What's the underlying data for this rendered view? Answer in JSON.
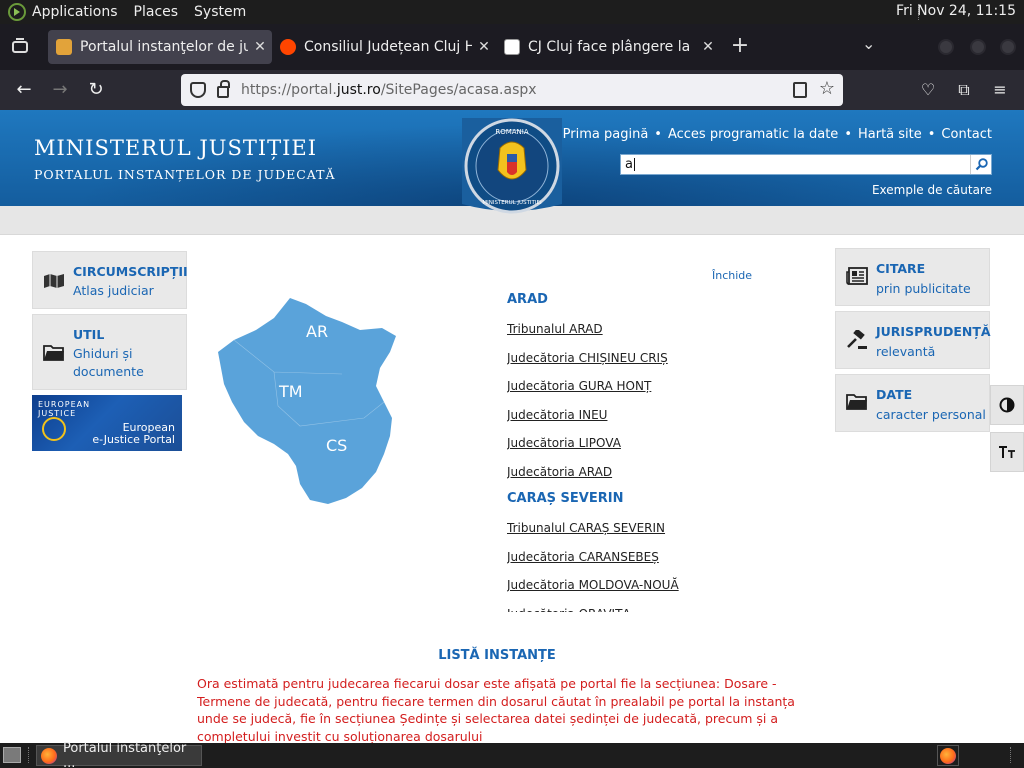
{
  "panel": {
    "menus": [
      "Applications",
      "Places",
      "System"
    ],
    "clock": "Fri Nov 24, 11:15"
  },
  "browser": {
    "tabs": [
      {
        "title": "Portalul instanţelor de judecată",
        "active": true
      },
      {
        "title": "Consiliul Județean Cluj Hacked",
        "active": false
      },
      {
        "title": "CJ Cluj face plângere la DIICOT",
        "active": false
      }
    ],
    "url_prefix": "https://portal.",
    "url_domain": "just.ro",
    "url_path": "/SitePages/acasa.aspx"
  },
  "header": {
    "title": "MINISTERUL JUSTIȚIEI",
    "subtitle": "PORTALUL INSTANȚELOR DE JUDECATĂ",
    "seal_top": "ROMANIA",
    "seal_bottom": "MINISTERUL JUSTITIEI",
    "links": [
      "Prima pagină",
      "Acces programatic la date",
      "Hartă site",
      "Contact"
    ],
    "search_value": "a",
    "search_examples": "Exemple de căutare"
  },
  "left_tiles": [
    {
      "title": "CIRCUMSCRIPȚII",
      "subtitle": "Atlas judiciar",
      "icon": "map-icon"
    },
    {
      "title": "UTIL",
      "subtitle_lines": [
        "Ghiduri și",
        "documente"
      ],
      "icon": "folder-icon"
    }
  ],
  "ejustice": {
    "logo_line1": "EUROPEAN",
    "logo_line2": "JUSTICE",
    "text_line1": "European",
    "text_line2": "e-Justice Portal"
  },
  "map": {
    "labels": [
      "AR",
      "TM",
      "CS"
    ],
    "fill": "#5aa3da"
  },
  "court_list": {
    "close_label": "Închide",
    "groups": [
      {
        "county": "ARAD",
        "courts": [
          "Tribunalul ARAD",
          "Judecătoria CHIȘINEU CRIȘ",
          "Judecătoria GURA HONȚ",
          "Judecătoria INEU",
          "Judecătoria LIPOVA",
          "Judecătoria ARAD"
        ]
      },
      {
        "county": "CARAȘ SEVERIN",
        "courts": [
          "Tribunalul CARAȘ SEVERIN",
          "Judecătoria CARANSEBEȘ",
          "Judecătoria MOLDOVA-NOUĂ",
          "Judecătoria ORAVIȚA"
        ]
      }
    ]
  },
  "right_tiles": [
    {
      "title": "CITARE",
      "subtitle": "prin publicitate",
      "icon": "newspaper-icon"
    },
    {
      "title": "JURISPRUDENȚĂ",
      "subtitle": "relevantă",
      "icon": "gavel-icon"
    },
    {
      "title": "DATE",
      "subtitle": "caracter personal",
      "icon": "folder-icon"
    }
  ],
  "list_title": "LISTĂ INSTANȚE",
  "notice": "Ora estimată pentru judecarea fiecarui dosar este afișată pe portal fie la secțiunea: Dosare - Termene de judecată, pentru fiecare termen din dosarul căutat în prealabil pe portal la instanța unde se judecă, fie în secțiunea Ședințe și selectarea datei ședinței de judecată, precum și a completului investit cu soluționarea dosarului",
  "taskbar": {
    "task_title": "Portalul instanţelor ..."
  },
  "colors": {
    "header_blue": "#1f78bf",
    "link_blue": "#1a66b3",
    "notice_red": "#d31e1e"
  }
}
